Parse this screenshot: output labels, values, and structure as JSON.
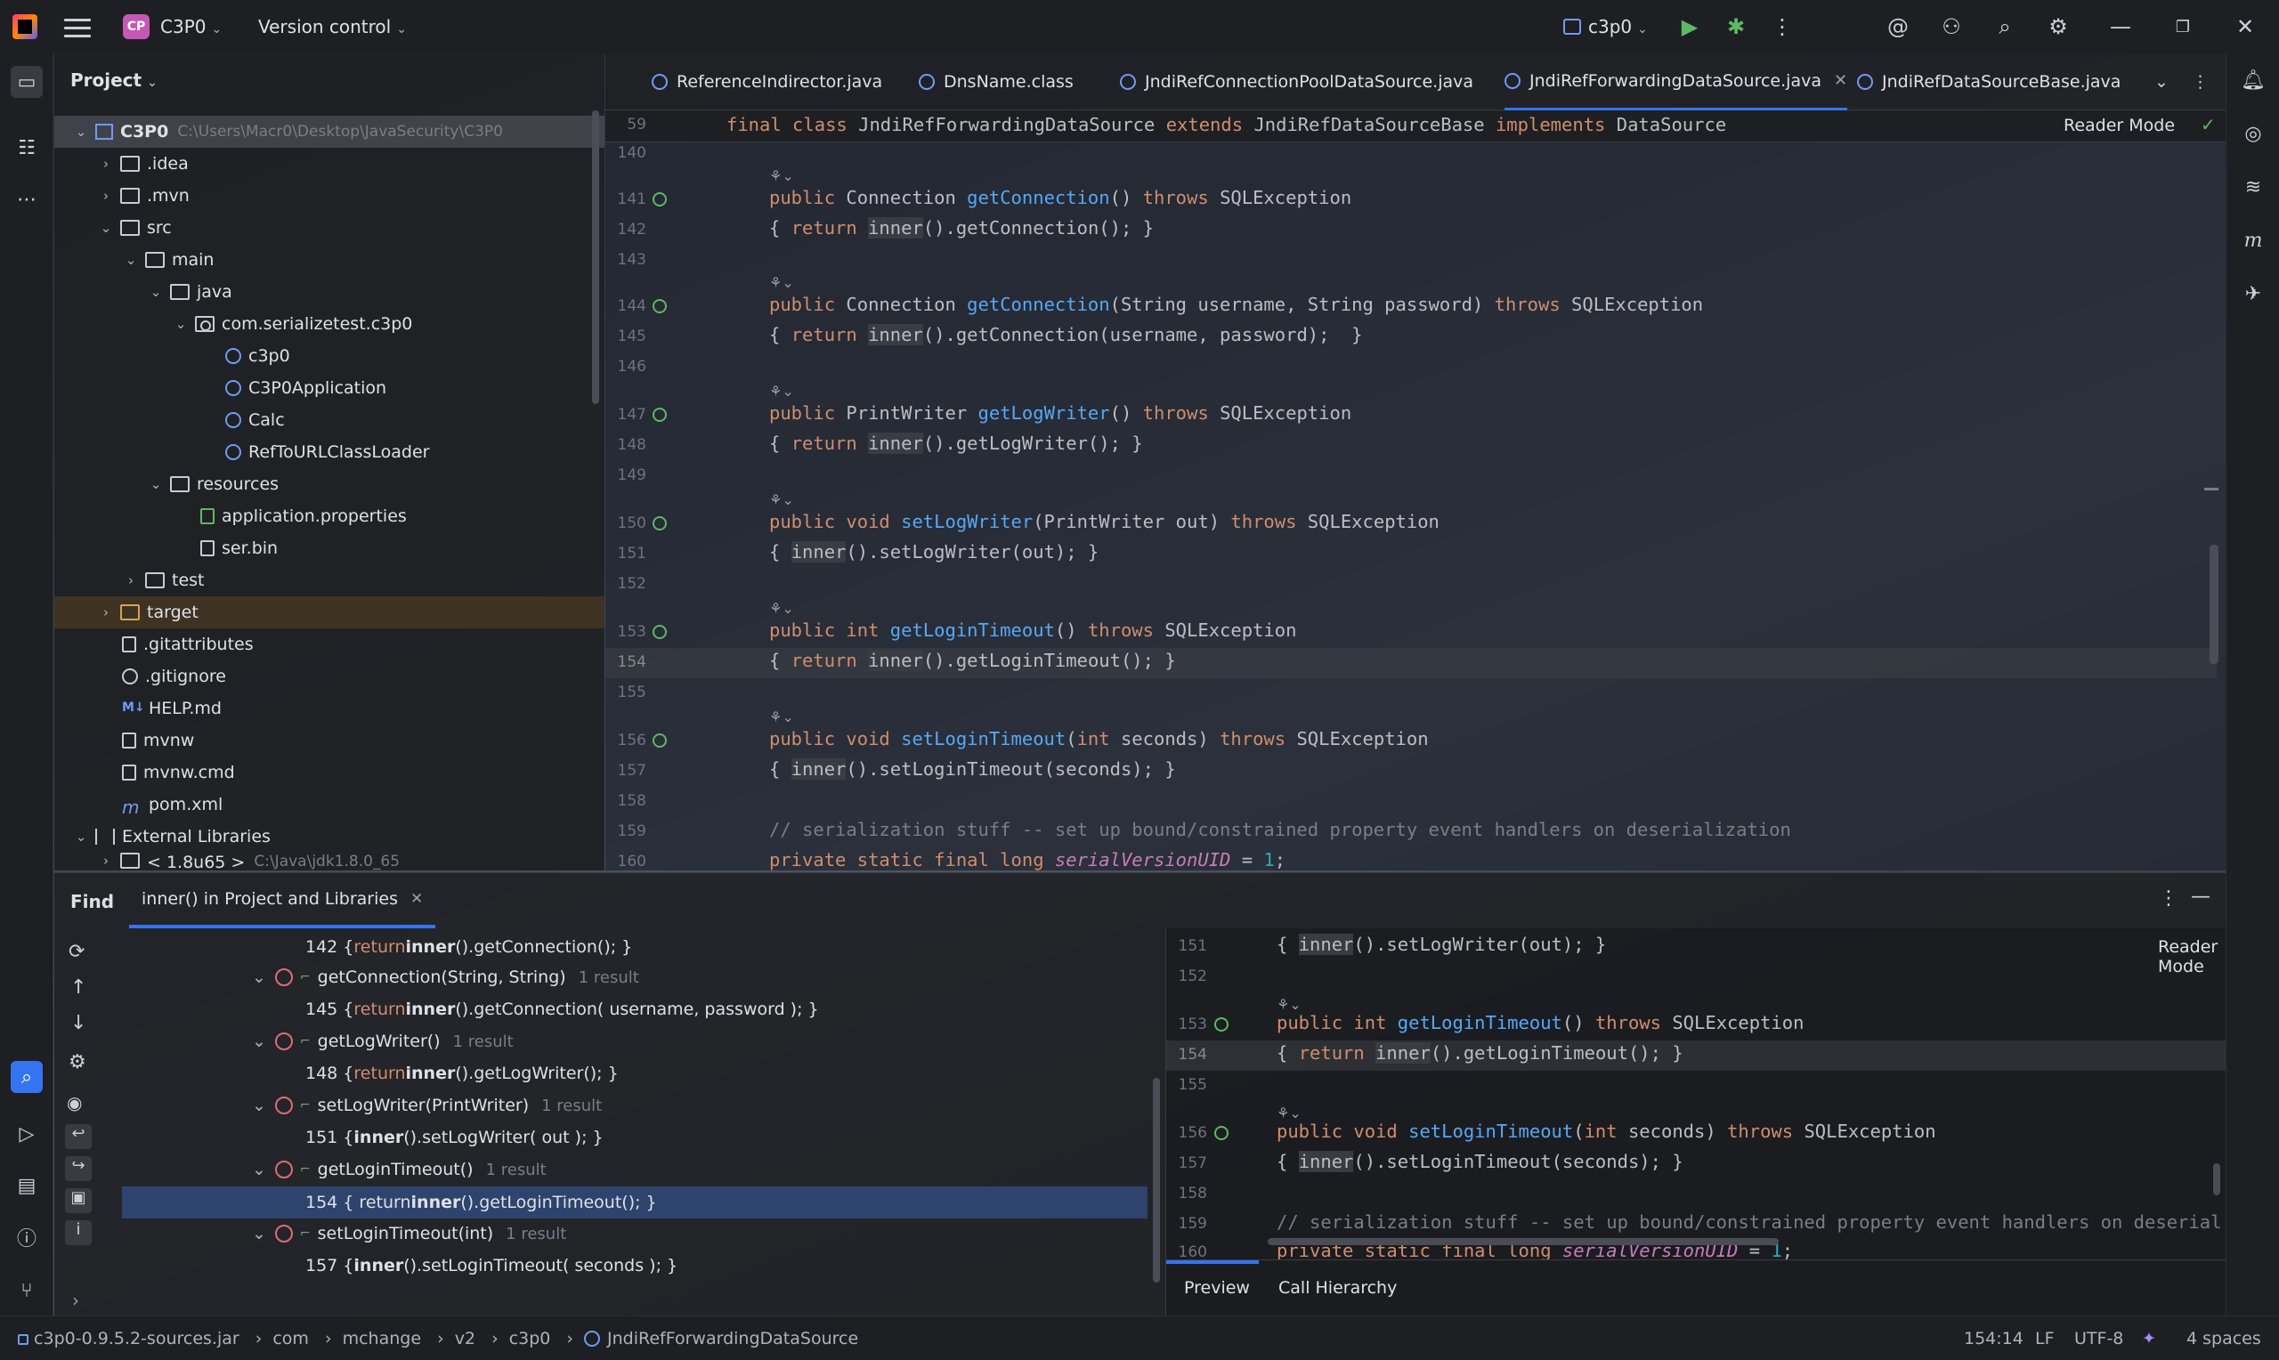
{
  "titlebar": {
    "project_badge": "CP",
    "project_name": "C3P0",
    "vcs": "Version control",
    "run_config": "c3p0"
  },
  "project_panel": {
    "title": "Project",
    "tree": [
      {
        "label": "C3P0",
        "path": "C:\\Users\\Macr0\\Desktop\\JavaSecurity\\C3P0",
        "icon": "module-icon"
      },
      {
        "label": ".idea",
        "icon": "folder-icon"
      },
      {
        "label": ".mvn",
        "icon": "folder-icon"
      },
      {
        "label": "src",
        "icon": "folder-icon"
      },
      {
        "label": "main",
        "icon": "folder-icon"
      },
      {
        "label": "java",
        "icon": "folder-icon"
      },
      {
        "label": "com.serializetest.c3p0",
        "icon": "package-icon"
      },
      {
        "label": "c3p0",
        "icon": "class-icon"
      },
      {
        "label": "C3P0Application",
        "icon": "class-icon"
      },
      {
        "label": "Calc",
        "icon": "class-icon"
      },
      {
        "label": "RefToURLClassLoader",
        "icon": "class-icon"
      },
      {
        "label": "resources",
        "icon": "folder-icon"
      },
      {
        "label": "application.properties",
        "icon": "properties-icon"
      },
      {
        "label": "ser.bin",
        "icon": "file-icon"
      },
      {
        "label": "test",
        "icon": "folder-icon"
      },
      {
        "label": "target",
        "icon": "folder-icon"
      },
      {
        "label": ".gitattributes",
        "icon": "file-icon"
      },
      {
        "label": ".gitignore",
        "icon": "ignore-icon"
      },
      {
        "label": "HELP.md",
        "icon": "markdown-icon"
      },
      {
        "label": "mvnw",
        "icon": "file-icon"
      },
      {
        "label": "mvnw.cmd",
        "icon": "file-icon"
      },
      {
        "label": "pom.xml",
        "icon": "maven-icon"
      },
      {
        "label": "External Libraries",
        "icon": "library-icon"
      },
      {
        "label": "< 1.8u65 >",
        "path": "C:\\Java\\jdk1.8.0_65",
        "icon": "folder-icon"
      }
    ]
  },
  "tabs": [
    {
      "label": "ReferenceIndirector.java"
    },
    {
      "label": "DnsName.class"
    },
    {
      "label": "JndiRefConnectionPoolDataSource.java"
    },
    {
      "label": "JndiRefForwardingDataSource.java"
    },
    {
      "label": "JndiRefDataSourceBase.java"
    }
  ],
  "editor": {
    "sticky_line_no": "59",
    "sticky": {
      "a": "final class ",
      "b": "JndiRefForwardingDataSource ",
      "c": "extends ",
      "d": "JndiRefDataSourceBase ",
      "e": "implements ",
      "f": "DataSource"
    },
    "reader_mode": "Reader Mode",
    "line_numbers": [
      "140",
      "141",
      "142",
      "143",
      "144",
      "145",
      "146",
      "147",
      "148",
      "149",
      "150",
      "151",
      "152",
      "153",
      "154",
      "155",
      "156",
      "157",
      "158",
      "159",
      "160"
    ],
    "code": {
      "l141": {
        "a": "public ",
        "b": "Connection ",
        "c": "getConnection",
        "d": "() ",
        "e": "throws ",
        "f": "SQLException"
      },
      "l142": {
        "a": "{ ",
        "b": "return ",
        "c": "inner",
        "d": "().getConnection(); }"
      },
      "l144": {
        "a": "public ",
        "b": "Connection ",
        "c": "getConnection",
        "d": "(String username, String password) ",
        "e": "throws ",
        "f": "SQLException"
      },
      "l145": {
        "a": "{ ",
        "b": "return ",
        "c": "inner",
        "d": "().getConnection(username, password);  }"
      },
      "l147": {
        "a": "public ",
        "b": "PrintWriter ",
        "c": "getLogWriter",
        "d": "() ",
        "e": "throws ",
        "f": "SQLException"
      },
      "l148": {
        "a": "{ ",
        "b": "return ",
        "c": "inner",
        "d": "().getLogWriter(); }"
      },
      "l150": {
        "a": "public void ",
        "c": "setLogWriter",
        "d": "(PrintWriter out) ",
        "e": "throws ",
        "f": "SQLException"
      },
      "l151": {
        "a": "{ ",
        "c": "inner",
        "d": "().setLogWriter(out); }"
      },
      "l153": {
        "a": "public int ",
        "c": "getLoginTimeout",
        "d": "() ",
        "e": "throws ",
        "f": "SQLException"
      },
      "l154": {
        "a": "{ ",
        "b": "return ",
        "c": "inner",
        "d": "().getLoginTimeout(); }"
      },
      "l156": {
        "a": "public void ",
        "c": "setLoginTimeout",
        "d": "(",
        "k": "int ",
        "g": "seconds) ",
        "e": "throws ",
        "f": "SQLException"
      },
      "l157": {
        "a": "{ ",
        "c": "inner",
        "d": "().setLoginTimeout(seconds); }"
      },
      "l159": "// serialization stuff -- set up bound/constrained property event handlers on deserialization",
      "l160": {
        "a": "private static final long ",
        "b": "serialVersionUID",
        "c": " = ",
        "d": "1",
        "e": ";"
      }
    }
  },
  "find": {
    "title": "Find",
    "tab": "inner() in Project and Libraries",
    "results": [
      {
        "type": "usage",
        "text_a": "142 { ",
        "kw": "return ",
        "bold": "inner",
        "text_b": "().getConnection(); }"
      },
      {
        "type": "method",
        "name": "getConnection(String, String)",
        "count": "1 result"
      },
      {
        "type": "usage",
        "text_a": "145 { ",
        "kw": "return ",
        "bold": "inner",
        "text_b": "().getConnection( username, password ); }"
      },
      {
        "type": "method",
        "name": "getLogWriter()",
        "count": "1 result"
      },
      {
        "type": "usage",
        "text_a": "148 { ",
        "kw": "return ",
        "bold": "inner",
        "text_b": "().getLogWriter(); }"
      },
      {
        "type": "method",
        "name": "setLogWriter(PrintWriter)",
        "count": "1 result"
      },
      {
        "type": "usage",
        "text_a": "151 { ",
        "kw": "",
        "bold": "inner",
        "text_b": "().setLogWriter( out ); }"
      },
      {
        "type": "method",
        "name": "getLoginTimeout()",
        "count": "1 result"
      },
      {
        "type": "usage",
        "text_a": "154 { return ",
        "kw": "",
        "bold": "inner",
        "text_b": "().getLoginTimeout(); }"
      },
      {
        "type": "method",
        "name": "setLoginTimeout(int)",
        "count": "1 result"
      },
      {
        "type": "usage",
        "text_a": "157 { ",
        "kw": "",
        "bold": "inner",
        "text_b": "().setLoginTimeout( seconds ); }"
      }
    ],
    "preview": {
      "reader_mode": "Reader Mode",
      "line_numbers": [
        "151",
        "152",
        "153",
        "154",
        "155",
        "156",
        "157",
        "158",
        "159",
        "160"
      ],
      "tabs": [
        "Preview",
        "Call Hierarchy"
      ]
    }
  },
  "statusbar": {
    "breadcrumbs": [
      "c3p0-0.9.5.2-sources.jar",
      "com",
      "mchange",
      "v2",
      "c3p0",
      "JndiRefForwardingDataSource"
    ],
    "position": "154:14",
    "line_sep": "LF",
    "encoding": "UTF-8",
    "indent": "4 spaces"
  }
}
